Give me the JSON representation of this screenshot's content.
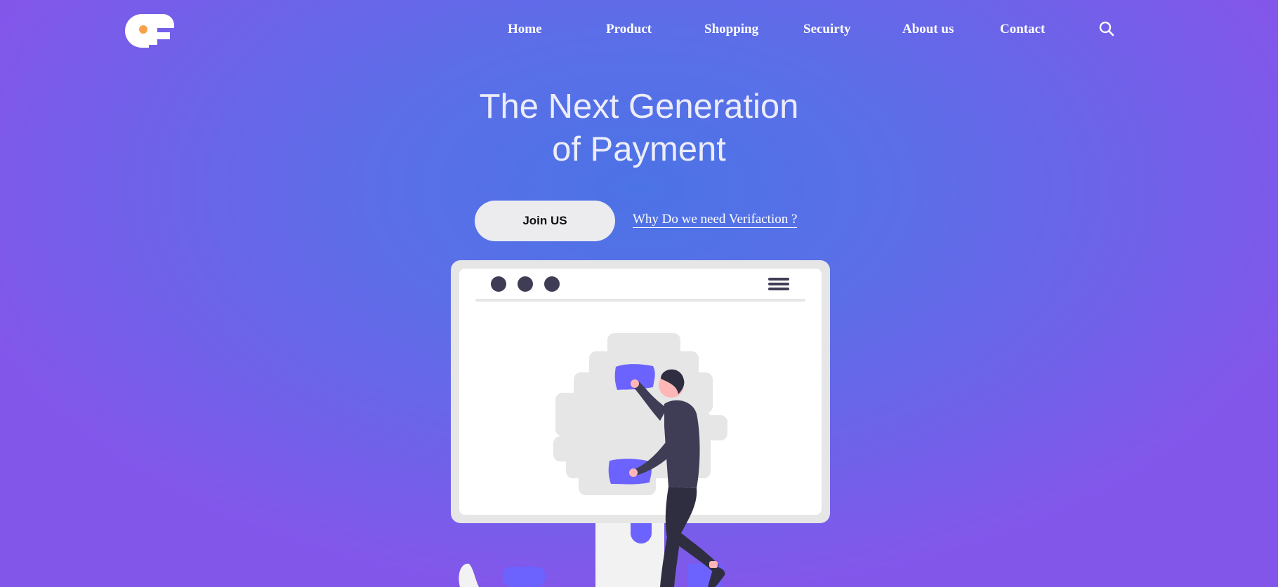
{
  "nav": {
    "items": [
      {
        "label": "Home"
      },
      {
        "label": "Product"
      },
      {
        "label": "Shopping"
      },
      {
        "label": "Secuirty"
      },
      {
        "label": "About us"
      },
      {
        "label": "Contact"
      }
    ],
    "search_icon": "search-icon"
  },
  "hero": {
    "title_line1": "The Next Generation",
    "title_line2": "of Payment",
    "cta_label": "Join US",
    "link_label": "Why Do we need Verifaction ?"
  },
  "colors": {
    "background_center": "#4c73e6",
    "background_edge": "#8356ea",
    "accent_purple": "#6c63ff",
    "dark_figure": "#3f3d56",
    "button_bg": "#ececef",
    "logo_dot": "#f7a24a"
  }
}
